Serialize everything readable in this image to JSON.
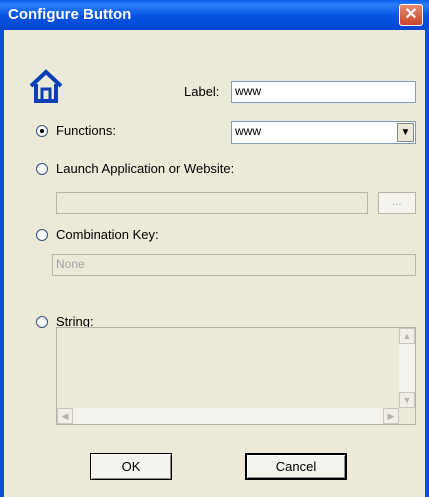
{
  "window": {
    "title": "Configure Button",
    "close": "✕"
  },
  "label_field": {
    "label": "Label:",
    "value": "www"
  },
  "functions": {
    "label": "Functions:",
    "value": "www",
    "selected": true
  },
  "launch": {
    "label": "Launch Application or Website:",
    "value": "",
    "browse_label": "...",
    "selected": false
  },
  "combination": {
    "label": "Combination Key:",
    "value": "None",
    "selected": false
  },
  "string": {
    "label": "String:",
    "value": "",
    "selected": false
  },
  "buttons": {
    "ok": "OK",
    "cancel": "Cancel"
  },
  "icons": {
    "home": "home-icon"
  },
  "colors": {
    "titlebar": "#0553e0",
    "dialog_bg": "#ece9d8",
    "icon": "#0a3fb8",
    "close": "#c9452b"
  }
}
